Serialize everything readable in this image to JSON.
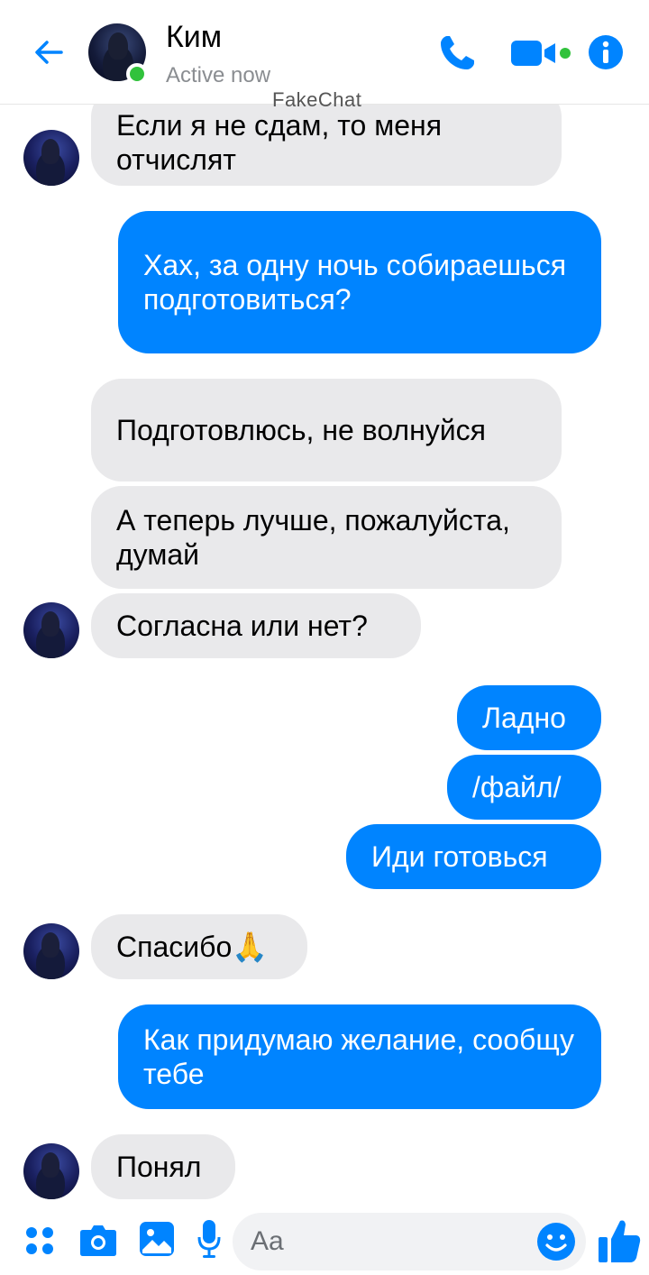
{
  "header": {
    "contact_name": "Ким",
    "status": "Active now",
    "watermark": "FakeChat"
  },
  "messages": [
    {
      "side": "in",
      "text": "Если я не сдам, то меня отчислят"
    },
    {
      "side": "out",
      "text": "Хах, за одну ночь собираешься подготовиться?"
    },
    {
      "side": "in",
      "text": "Подготовлюсь, не волнуйся"
    },
    {
      "side": "in",
      "text": "А теперь лучше, пожалуйста, думай"
    },
    {
      "side": "in",
      "text": "Согласна или нет?"
    },
    {
      "side": "out",
      "text": "Ладно"
    },
    {
      "side": "out",
      "text": "/файл/"
    },
    {
      "side": "out",
      "text": "Иди готовься"
    },
    {
      "side": "in",
      "text": "Спасибо🙏"
    },
    {
      "side": "out",
      "text": "Как придумаю желание, сообщу тебе"
    },
    {
      "side": "in",
      "text": "Понял"
    }
  ],
  "composer": {
    "placeholder": "Aa"
  },
  "colors": {
    "accent": "#0084ff",
    "incoming_bubble": "#e9e9eb",
    "online": "#31c23c"
  },
  "icons": [
    "back-arrow-icon",
    "phone-icon",
    "video-icon",
    "info-icon",
    "apps-icon",
    "camera-icon",
    "gallery-icon",
    "microphone-icon",
    "emoji-icon",
    "thumbs-up-icon"
  ]
}
